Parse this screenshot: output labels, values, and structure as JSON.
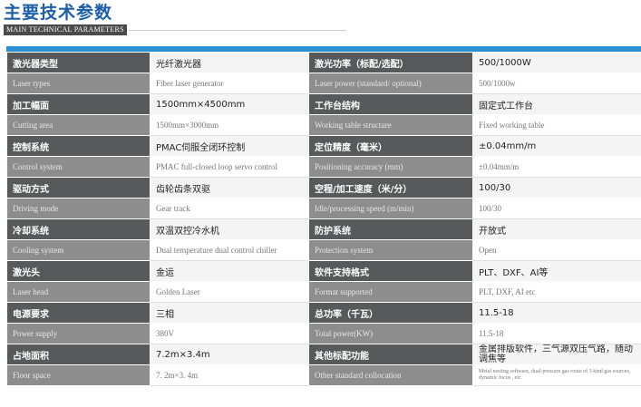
{
  "header": {
    "title": "主要技术参数",
    "subtitle": "MAIN TECHNICAL PARAMETERS"
  },
  "colors": {
    "title_blue": "#1d5fa8",
    "band_blue": "#2b8fd6",
    "label_dark": "#58595b",
    "label_light": "#8d8d8d"
  },
  "rows": [
    {
      "left": {
        "cn_label": "激光器类型",
        "cn_value": "光纤激光器",
        "en_label": "Laser types",
        "en_value": "Fiber laser generator"
      },
      "right": {
        "cn_label": "激光功率（标配/选配）",
        "cn_value": "500/1000W",
        "en_label": "Laser power (standard/ optional)",
        "en_value": "500/1000w"
      }
    },
    {
      "left": {
        "cn_label": "加工幅面",
        "cn_value": "1500mm×4500mm",
        "en_label": "Cutting area",
        "en_value": "1500mm×3000mm"
      },
      "right": {
        "cn_label": "工作台结构",
        "cn_value": "固定式工作台",
        "en_label": "Working table structure",
        "en_value": "Fixed working table"
      }
    },
    {
      "left": {
        "cn_label": "控制系统",
        "cn_value": "PMAC伺服全闭环控制",
        "en_label": "Control system",
        "en_value": "PMAC full-closed loop servo control"
      },
      "right": {
        "cn_label": "定位精度（毫米）",
        "cn_value": "±0.04mm/m",
        "en_label": "Positioning accuracy (mm)",
        "en_value": "±0.04mm/m"
      }
    },
    {
      "left": {
        "cn_label": "驱动方式",
        "cn_value": "齿轮齿条双驱",
        "en_label": "Driving mode",
        "en_value": "Gear track"
      },
      "right": {
        "cn_label": "空程/加工速度（米/分）",
        "cn_value": "100/30",
        "en_label": "Idle/processing speed (m/min)",
        "en_value": "100/30"
      }
    },
    {
      "left": {
        "cn_label": "冷却系统",
        "cn_value": "双温双控冷水机",
        "en_label": "Cooling system",
        "en_value": "Dual temperature dual control chiller"
      },
      "right": {
        "cn_label": "防护系统",
        "cn_value": "开放式",
        "en_label": "Protection system",
        "en_value": "Open"
      }
    },
    {
      "left": {
        "cn_label": "激光头",
        "cn_value": "金运",
        "en_label": "Laser head",
        "en_value": "Golden Laser"
      },
      "right": {
        "cn_label": "软件支持格式",
        "cn_value": "PLT、DXF、AI等",
        "en_label": "Format supported",
        "en_value": "PLT, DXF, AI etc"
      }
    },
    {
      "left": {
        "cn_label": "电源要求",
        "cn_value": "三相",
        "en_label": "Power supply",
        "en_value": "380V"
      },
      "right": {
        "cn_label": "总功率（千瓦）",
        "cn_value": "11.5-18",
        "en_label": "Total power(KW)",
        "en_value": "11.5-18"
      }
    },
    {
      "left": {
        "cn_label": "占地面积",
        "cn_value": "7.2m×3.4m",
        "en_label": "Floor space",
        "en_value": "7. 2m×3. 4m"
      },
      "right": {
        "cn_label": "其他标配功能",
        "cn_value": "金属排版软件，三气源双压气路，随动调焦等",
        "en_label": "Other standard collocation",
        "en_value": "Metal nesting software, dual-pressure gas route of 3 kind gas sources, dynamic focus , etc."
      }
    }
  ]
}
